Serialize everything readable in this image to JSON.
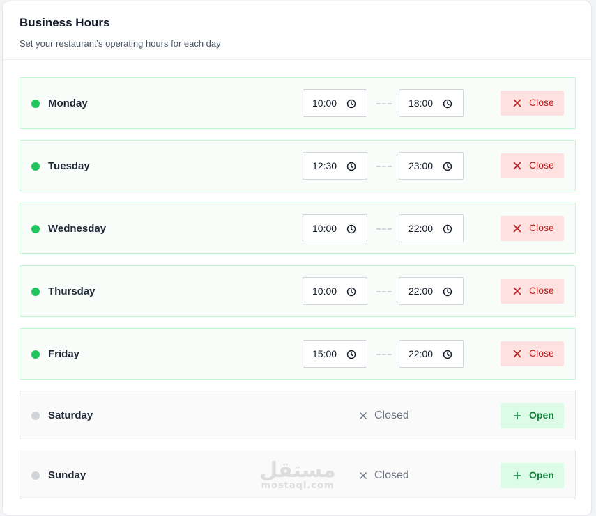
{
  "header": {
    "title": "Business Hours",
    "subtitle": "Set your restaurant's operating hours for each day"
  },
  "colors": {
    "open_dot": "#22c55e",
    "closed_dot": "#d1d5db",
    "close_button_bg": "#fee2e2",
    "close_button_text": "#b91c1c",
    "open_button_bg": "#dcfce7",
    "open_button_text": "#15803d"
  },
  "days": [
    {
      "name": "Monday",
      "open": "10:00",
      "close": "18:00",
      "action_label": "Close"
    },
    {
      "name": "Tuesday",
      "open": "12:30",
      "close": "23:00",
      "action_label": "Close"
    },
    {
      "name": "Wednesday",
      "open": "10:00",
      "close": "22:00",
      "action_label": "Close"
    },
    {
      "name": "Thursday",
      "open": "10:00",
      "close": "22:00",
      "action_label": "Close"
    },
    {
      "name": "Friday",
      "open": "15:00",
      "close": "22:00",
      "action_label": "Close"
    },
    {
      "name": "Saturday",
      "status": "Closed",
      "action_label": "Open"
    },
    {
      "name": "Sunday",
      "status": "Closed",
      "action_label": "Open"
    }
  ],
  "icons": {
    "time": "clock-icon",
    "close_action": "x-icon",
    "open_action": "plus-icon",
    "closed_status": "x-icon"
  },
  "watermark": {
    "arabic": "مستقل",
    "latin": "mostaql.com"
  }
}
